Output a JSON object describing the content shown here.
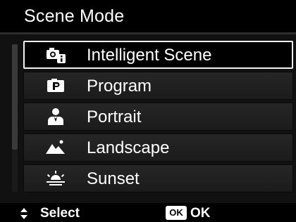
{
  "header": {
    "title": "Scene Mode"
  },
  "menu": {
    "selected_index": 0,
    "items": [
      {
        "label": "Intelligent Scene",
        "icon": "intelligent-scene-icon"
      },
      {
        "label": "Program",
        "icon": "program-icon"
      },
      {
        "label": "Portrait",
        "icon": "portrait-icon"
      },
      {
        "label": "Landscape",
        "icon": "landscape-icon"
      },
      {
        "label": "Sunset",
        "icon": "sunset-icon"
      }
    ]
  },
  "footer": {
    "select_label": "Select",
    "ok_badge": "OK",
    "ok_label": "OK"
  },
  "colors": {
    "background": "#000000",
    "item_background": "#222222",
    "selection_border": "#f2f2f2",
    "text": "#ffffff"
  }
}
